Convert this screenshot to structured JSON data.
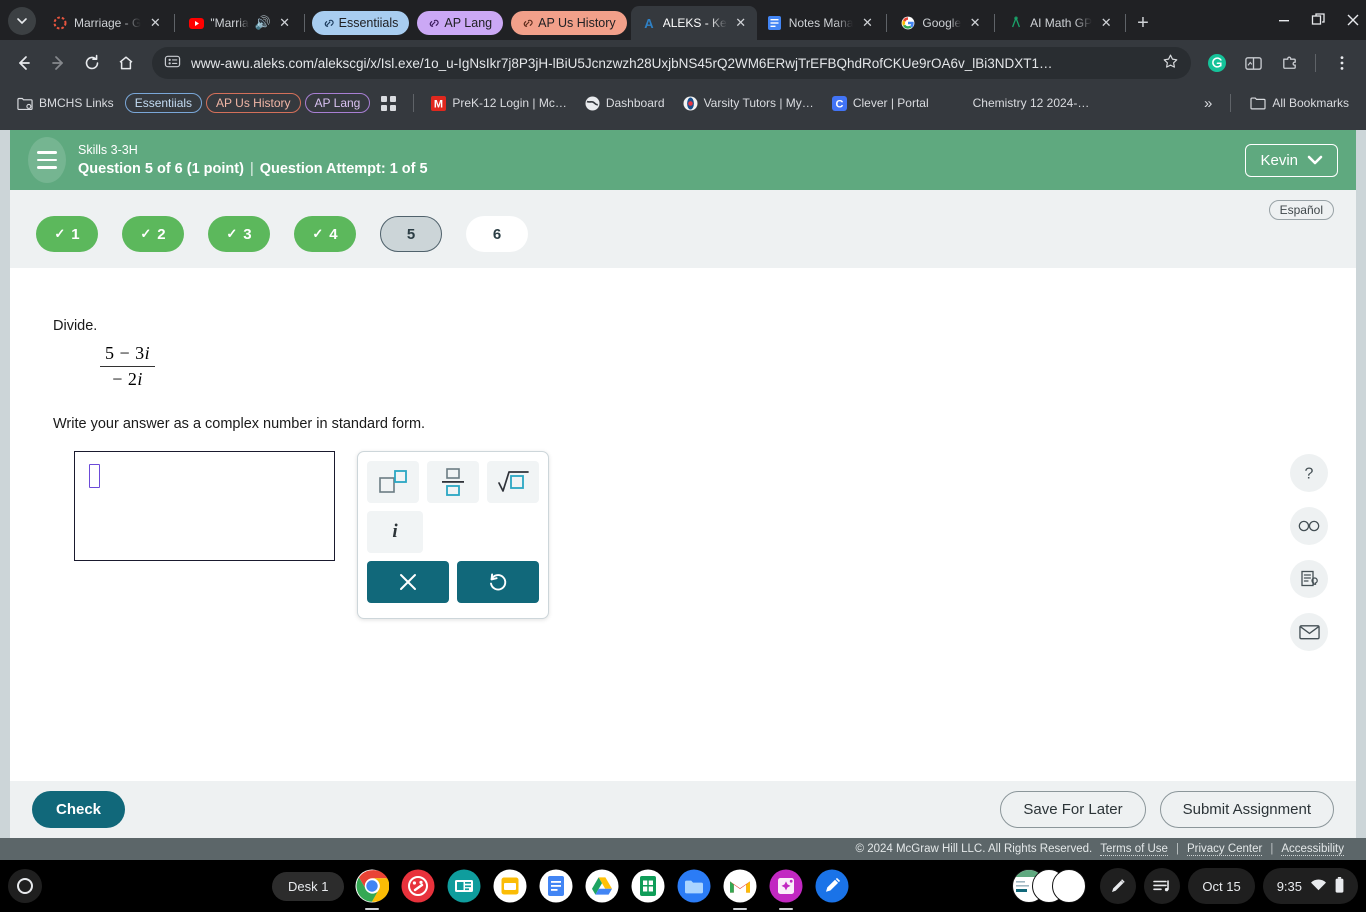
{
  "browser": {
    "tabs": [
      {
        "title": "Marriage - G",
        "icon": "dashed-circle-icon",
        "type": "normal",
        "active": false,
        "has_audio": false
      },
      {
        "title": "\"Marria",
        "icon": "youtube-icon",
        "type": "normal",
        "active": false,
        "has_audio": true
      },
      {
        "title": "Essentiials",
        "icon": "link-icon",
        "type": "group-pill",
        "color": "#a8cdf0",
        "active": false
      },
      {
        "title": "AP Lang",
        "icon": "link-icon",
        "type": "group-pill",
        "color": "#cba8f5",
        "active": false
      },
      {
        "title": "AP Us History",
        "icon": "link-icon",
        "type": "group-pill",
        "color": "#f2a08a",
        "active": false
      },
      {
        "title": "ALEKS - Ke",
        "icon": "aleks-icon",
        "type": "normal",
        "active": true,
        "has_audio": false
      },
      {
        "title": "Notes Mana",
        "icon": "notes-icon",
        "type": "normal",
        "active": false,
        "has_audio": false
      },
      {
        "title": "Google",
        "icon": "google-icon",
        "type": "normal",
        "active": false,
        "has_audio": false
      },
      {
        "title": "AI Math GP",
        "icon": "compass-icon",
        "type": "normal",
        "active": false,
        "has_audio": false
      }
    ],
    "new_tab_label": "+",
    "url": "www-awu.aleks.com/alekscgi/x/Isl.exe/1o_u-IgNsIkr7j8P3jH-lBiU5Jcnzwzh28UxjbNS45rQ2WM6ERwjTrEFBQhdRofCKUe9rOA6v_lBi3NDXT1…",
    "bookmarks": [
      {
        "label": "BMCHS Links",
        "kind": "folder"
      },
      {
        "label": "Essentiials",
        "kind": "pill",
        "color": "#7aa7d8"
      },
      {
        "label": "AP Us History",
        "kind": "pill",
        "color": "#d4705a"
      },
      {
        "label": "AP Lang",
        "kind": "pill",
        "color": "#a87fd4"
      },
      {
        "label": "",
        "kind": "apps-grid"
      },
      {
        "label": "PreK-12 Login | Mc…",
        "kind": "mcgraw"
      },
      {
        "label": "Dashboard",
        "kind": "globe"
      },
      {
        "label": "Varsity Tutors | My…",
        "kind": "varsity"
      },
      {
        "label": "Clever | Portal",
        "kind": "clever"
      },
      {
        "label": "Chemistry 12 2024-…",
        "kind": "plain"
      }
    ],
    "bookmarks_overflow": "»",
    "all_bookmarks_label": "All Bookmarks"
  },
  "aleks": {
    "header": {
      "skill_label": "Skills 3-3H",
      "question_label": "Question 5 of 6 (1 point)",
      "separator": "|",
      "attempt_label": "Question Attempt: 1 of 5",
      "user_name": "Kevin"
    },
    "language_toggle": "Español",
    "question_nav": [
      {
        "number": "1",
        "state": "done"
      },
      {
        "number": "2",
        "state": "done"
      },
      {
        "number": "3",
        "state": "done"
      },
      {
        "number": "4",
        "state": "done"
      },
      {
        "number": "5",
        "state": "current"
      },
      {
        "number": "6",
        "state": "todo"
      }
    ],
    "question": {
      "prompt": "Divide.",
      "numerator": "5 − 3",
      "numerator_imaginary": "i",
      "denominator": "− 2",
      "denominator_imaginary": "i",
      "instruction": "Write your answer as a complex number in standard form."
    },
    "answer_input": {
      "value": "",
      "cursor_visible": true
    },
    "keypad": {
      "keys": [
        {
          "name": "exponent-key",
          "label": "□^□"
        },
        {
          "name": "fraction-key",
          "label": "□/□"
        },
        {
          "name": "square-root-key",
          "label": "√□"
        },
        {
          "name": "imaginary-unit-key",
          "label": "i"
        }
      ],
      "clear_label": "×",
      "undo_label": "↺"
    },
    "tools": [
      {
        "name": "help-icon",
        "label": "?"
      },
      {
        "name": "glasses-icon",
        "label": "∞"
      },
      {
        "name": "explanation-icon",
        "label": "doc"
      },
      {
        "name": "message-icon",
        "label": "✉"
      }
    ],
    "actions": {
      "check_label": "Check",
      "save_label": "Save For Later",
      "submit_label": "Submit Assignment"
    },
    "footer": {
      "copyright": "© 2024 McGraw Hill LLC. All Rights Reserved.",
      "terms": "Terms of Use",
      "privacy": "Privacy Center",
      "accessibility": "Accessibility",
      "pipe": "|"
    }
  },
  "shelf": {
    "desk_label": "Desk 1",
    "apps": [
      {
        "name": "chrome-icon"
      },
      {
        "name": "paint-icon"
      },
      {
        "name": "slides-icon"
      },
      {
        "name": "keep-icon"
      },
      {
        "name": "docs-icon"
      },
      {
        "name": "drive-icon"
      },
      {
        "name": "sheets-icon"
      },
      {
        "name": "files-icon"
      },
      {
        "name": "gmail-icon"
      },
      {
        "name": "photos-icon"
      },
      {
        "name": "sketch-icon"
      }
    ],
    "date": "Oct 15",
    "time": "9:35"
  },
  "colors": {
    "aleks_green": "#5fa97f",
    "teal": "#11687a",
    "done_green": "#5cb85c",
    "purple_caret": "#6c4bd8"
  }
}
